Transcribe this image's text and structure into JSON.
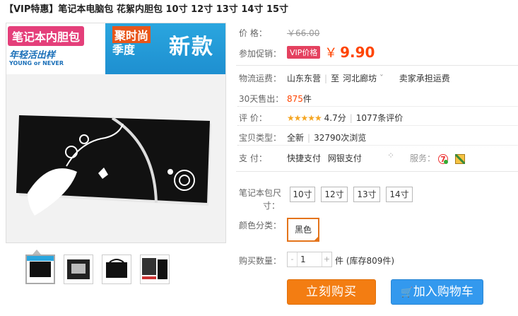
{
  "title": "【VIP特惠】笔记本电脑包 花絮内胆包 10寸 12寸 13寸 14寸 15寸",
  "banner": {
    "tag": "笔记本内胆包",
    "slogan": "年轻活出样",
    "slogan_en": "YOUNG or NEVER",
    "promo_small_1": "聚时尚",
    "promo_small_2": "季度",
    "promo_big": "新款"
  },
  "price_row": {
    "label": "价    格：",
    "value": "￥66.00"
  },
  "promo_row": {
    "label": "参加促销：",
    "badge": "VIP价格",
    "currency": "￥",
    "price": "9.90"
  },
  "shipping_row": {
    "label": "物流运费：",
    "from": "山东东营",
    "to": "河北廊坊",
    "arrow": "ˇ",
    "note": "卖家承担运费"
  },
  "sales_row": {
    "label": "30天售出：",
    "count": "875",
    "unit": "件"
  },
  "rating_row": {
    "label": "评    价：",
    "stars": "★★★★★",
    "score": "4.7分",
    "reviews": "1077条评价"
  },
  "type_row": {
    "label": "宝贝类型：",
    "condition": "全新",
    "views": "32790次浏览"
  },
  "pay_row": {
    "label": "支    付：",
    "method1": "快捷支付",
    "method2": "网银支付",
    "service_label": "服务："
  },
  "size_row": {
    "label_1": "笔记本包尺",
    "label_2": "寸：",
    "options": [
      "10寸",
      "12寸",
      "13寸",
      "14寸"
    ]
  },
  "color_row": {
    "label": "颜色分类：",
    "selected": "黑色"
  },
  "qty_row": {
    "label": "购买数量：",
    "minus": "-",
    "value": "1",
    "plus": "+",
    "stock": "件 (库存809件)"
  },
  "buttons": {
    "buy": "立刻购买",
    "cart": "加入购物车"
  },
  "colors": {
    "accent": "#ff4400",
    "buy": "#f37d12",
    "cart": "#3399ee",
    "vip": "#e4415f"
  }
}
